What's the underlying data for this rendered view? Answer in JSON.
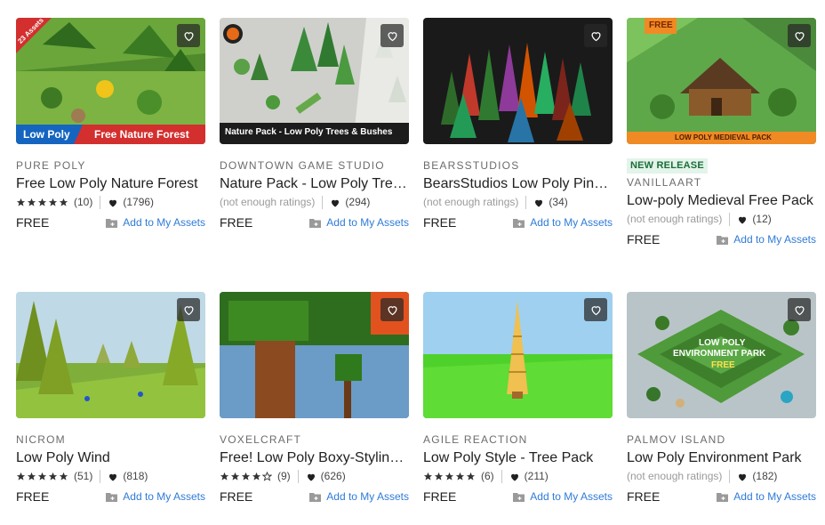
{
  "colors": {
    "accent": "#2f7bd8",
    "badge_bg": "#e3f4ea",
    "badge_text": "#1b6e37"
  },
  "cards": [
    {
      "publisher": "PURE POLY",
      "title": "Free Low Poly Nature Forest",
      "rating_stars": 5,
      "rating_count": "(10)",
      "favorites": "(1796)",
      "price": "FREE",
      "add_label": "Add to My Assets",
      "image": {
        "ribbon_text": "23 Assets",
        "banner_left": "Low Poly",
        "banner_right": "Free Nature Forest"
      }
    },
    {
      "publisher": "DOWNTOWN GAME STUDIO",
      "title": "Nature Pack - Low Poly Trees & Bushes",
      "rating_text": "(not enough ratings)",
      "favorites": "(294)",
      "price": "FREE",
      "add_label": "Add to My Assets",
      "image": {
        "banner": "Nature Pack - Low Poly Trees & Bushes"
      }
    },
    {
      "publisher": "BEARSSTUDIOS",
      "title": "BearsStudios Low Poly Pine Trees",
      "rating_text": "(not enough ratings)",
      "favorites": "(34)",
      "price": "FREE",
      "add_label": "Add to My Assets",
      "image": {}
    },
    {
      "badge": "NEW RELEASE",
      "publisher": "VANILLAART",
      "title": "Low-poly Medieval Free Pack",
      "rating_text": "(not enough ratings)",
      "favorites": "(12)",
      "price": "FREE",
      "add_label": "Add to My Assets",
      "image": {
        "tag": "FREE",
        "banner": "LOW POLY MEDIEVAL PACK"
      }
    },
    {
      "publisher": "NICROM",
      "title": "Low Poly Wind",
      "rating_stars": 5,
      "rating_count": "(51)",
      "favorites": "(818)",
      "price": "FREE",
      "add_label": "Add to My Assets",
      "image": {}
    },
    {
      "publisher": "VOXELCRAFT",
      "title": "Free! Low Poly Boxy-Styling Trees",
      "rating_stars": 4,
      "rating_count": "(9)",
      "favorites": "(626)",
      "price": "FREE",
      "add_label": "Add to My Assets",
      "image": {}
    },
    {
      "publisher": "AGILE REACTION",
      "title": "Low Poly Style - Tree Pack",
      "rating_stars": 5,
      "rating_count": "(6)",
      "favorites": "(211)",
      "price": "FREE",
      "add_label": "Add to My Assets",
      "image": {}
    },
    {
      "publisher": "PALMOV ISLAND",
      "title": "Low Poly Environment Park",
      "rating_text": "(not enough ratings)",
      "favorites": "(182)",
      "price": "FREE",
      "add_label": "Add to My Assets",
      "image": {
        "title_line1": "LOW POLY",
        "title_line2": "ENVIRONMENT PARK",
        "title_line3": "FREE"
      }
    }
  ]
}
